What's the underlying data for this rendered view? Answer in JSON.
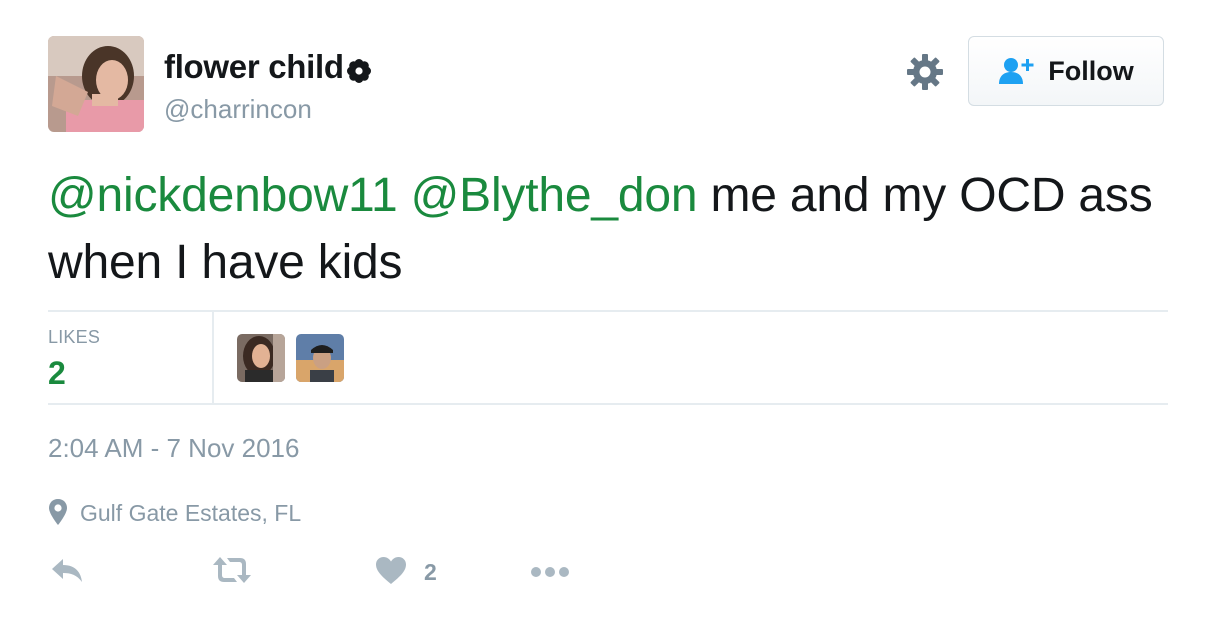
{
  "user": {
    "display_name": "flower child",
    "handle": "@charrincon",
    "name_emoji": "flower-icon"
  },
  "header": {
    "settings_icon": "gear-icon",
    "follow_label": "Follow",
    "follow_icon": "person-add-icon"
  },
  "tweet": {
    "mention1": "@nickdenbow11",
    "mention2": "@Blythe_don",
    "text": " me and my OCD ass when I have kids"
  },
  "stats": {
    "likes_label": "LIKES",
    "likes_count": "2"
  },
  "meta": {
    "timestamp": "2:04 AM - 7 Nov 2016",
    "location": "Gulf Gate Estates, FL"
  },
  "actions": {
    "reply_icon": "reply-icon",
    "retweet_icon": "retweet-icon",
    "like_icon": "heart-icon",
    "like_count": "2",
    "more_icon": "more-icon"
  },
  "colors": {
    "mention": "#1a8a3e",
    "muted": "#8899a6",
    "text": "#14171a"
  }
}
